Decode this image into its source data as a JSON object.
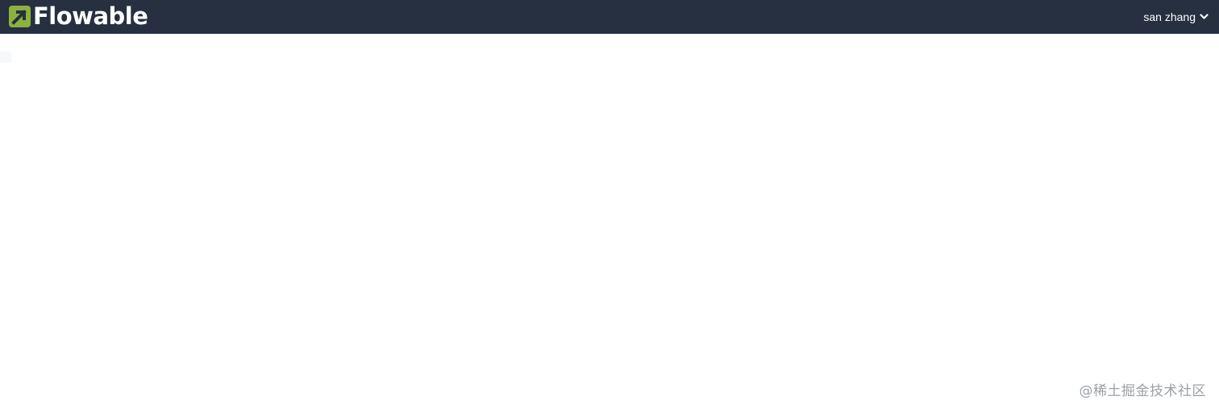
{
  "header": {
    "brand": "Flowable",
    "brand_icon": "flowable-logo-icon",
    "background_color": "#263040",
    "logo_accent_color": "#8cb13d",
    "user": {
      "name": "san zhang",
      "menu_icon": "chevron-down-icon"
    }
  },
  "main": {
    "background_color": "#ffffff"
  },
  "watermark": {
    "text": "@稀土掘金技术社区"
  }
}
